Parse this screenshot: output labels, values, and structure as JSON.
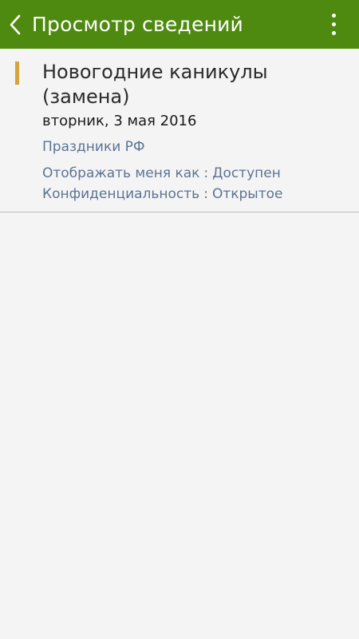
{
  "header": {
    "title": "Просмотр сведений",
    "back_icon": "chevron-left-icon",
    "more_icon": "more-vertical-icon",
    "background_color": "#4f8a10"
  },
  "event": {
    "title": "Новогодние каникулы (замена)",
    "date": "вторник, 3 мая 2016",
    "calendar": "Праздники РФ",
    "calendar_color": "#d4a33a",
    "details": [
      {
        "label": "Отображать меня как",
        "separator": ":",
        "value": "Доступен"
      },
      {
        "label": "Конфиденциальность",
        "separator": ":",
        "value": "Открытое"
      }
    ]
  }
}
